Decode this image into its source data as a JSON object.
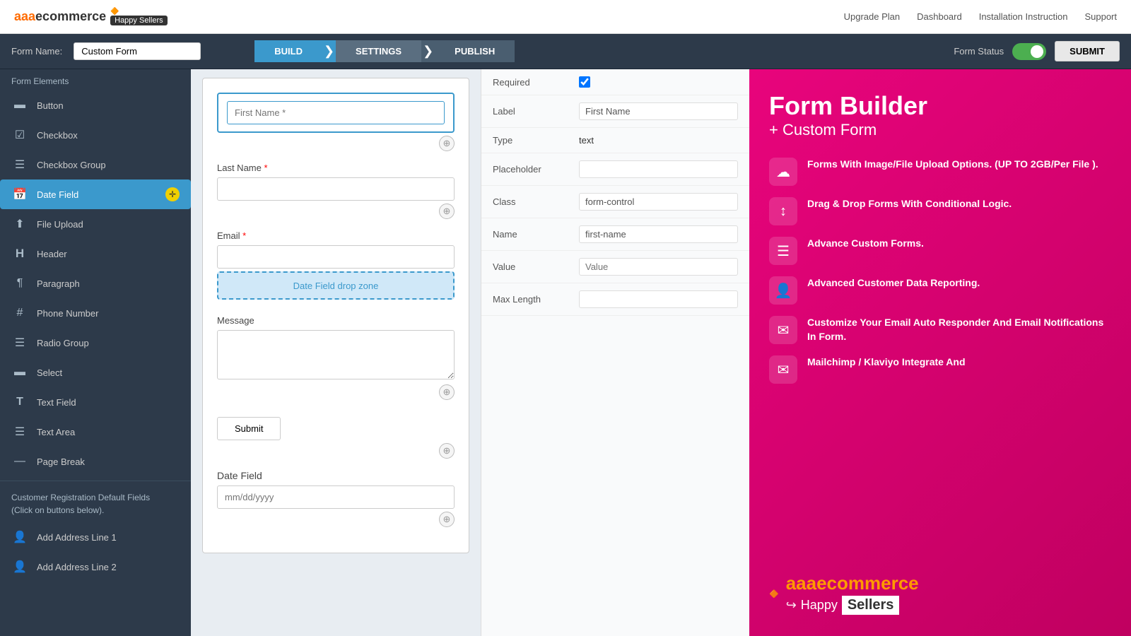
{
  "topNav": {
    "logo": "aaaecommerce",
    "logoHighlight": "aaa",
    "logoSub": "Happy Sellers",
    "links": [
      "Upgrade Plan",
      "Dashboard",
      "Installation Instruction",
      "Support"
    ]
  },
  "formHeader": {
    "formNameLabel": "Form Name:",
    "formNameValue": "Custom Form",
    "tabs": [
      "BUILD",
      "SETTINGS",
      "PUBLISH"
    ],
    "activeTab": "BUILD",
    "formStatusLabel": "Form Status",
    "submitLabel": "SUBMIT"
  },
  "sidebar": {
    "sectionTitle": "Form Elements",
    "items": [
      {
        "id": "button",
        "label": "Button",
        "icon": "▬"
      },
      {
        "id": "checkbox",
        "label": "Checkbox",
        "icon": "☑"
      },
      {
        "id": "checkbox-group",
        "label": "Checkbox Group",
        "icon": "☰"
      },
      {
        "id": "date-field",
        "label": "Date Field",
        "icon": "📅",
        "disabled": true
      },
      {
        "id": "file-upload",
        "label": "File Upload",
        "icon": "⬆"
      },
      {
        "id": "header",
        "label": "Header",
        "icon": "H"
      },
      {
        "id": "paragraph",
        "label": "Paragraph",
        "icon": "¶"
      },
      {
        "id": "phone-number",
        "label": "Phone Number",
        "icon": "#"
      },
      {
        "id": "radio-group",
        "label": "Radio Group",
        "icon": "☰"
      },
      {
        "id": "select",
        "label": "Select",
        "icon": "▬"
      },
      {
        "id": "text-field",
        "label": "Text Field",
        "icon": "T"
      },
      {
        "id": "text-area",
        "label": "Text Area",
        "icon": "☰"
      },
      {
        "id": "page-break",
        "label": "Page Break",
        "icon": "—"
      }
    ],
    "draggingItem": "date-field",
    "customerRegTitle": "Customer Registration Default Fields",
    "customerRegSub": "(Click on buttons below).",
    "addressItems": [
      {
        "id": "add-address-1",
        "label": "Add Address Line 1",
        "icon": "👤"
      },
      {
        "id": "add-address-2",
        "label": "Add Address Line 2",
        "icon": "👤"
      }
    ]
  },
  "formCanvas": {
    "fields": [
      {
        "id": "first-name",
        "label": "First Name",
        "required": true,
        "type": "text",
        "placeholder": "",
        "active": true
      },
      {
        "id": "last-name",
        "label": "Last Name",
        "required": true,
        "type": "text",
        "placeholder": ""
      },
      {
        "id": "email",
        "label": "Email",
        "required": true,
        "type": "text",
        "placeholder": ""
      },
      {
        "id": "message",
        "label": "Message",
        "type": "textarea",
        "placeholder": ""
      },
      {
        "id": "submit",
        "label": "Submit",
        "type": "submit"
      },
      {
        "id": "date-field",
        "label": "Date Field",
        "type": "date",
        "placeholder": "mm/dd/yyyy"
      }
    ]
  },
  "propertiesPanel": {
    "required": true,
    "label": "First Name",
    "type": "text",
    "placeholder": "",
    "class": "form-control",
    "name": "first-name",
    "value": "Value",
    "maxLength": "",
    "fields": [
      {
        "key": "required",
        "label": "Required",
        "type": "checkbox",
        "value": true
      },
      {
        "key": "label",
        "label": "Label",
        "type": "text",
        "value": "First Name"
      },
      {
        "key": "type",
        "label": "Type",
        "type": "text",
        "value": "text"
      },
      {
        "key": "placeholder",
        "label": "Placeholder",
        "type": "text",
        "value": ""
      },
      {
        "key": "class",
        "label": "Class",
        "type": "text",
        "value": "form-control"
      },
      {
        "key": "name",
        "label": "Name",
        "type": "text",
        "value": "first-name"
      },
      {
        "key": "value",
        "label": "Value",
        "type": "text",
        "value": "Value"
      },
      {
        "key": "maxLength",
        "label": "Max Length",
        "type": "text",
        "value": ""
      }
    ]
  },
  "rightPanel": {
    "title": "Form Builder",
    "subtitle": "+ Custom Form",
    "features": [
      {
        "icon": "☁",
        "text": "Forms With Image/File Upload Options. (UP TO 2GB/Per File )."
      },
      {
        "icon": "↕",
        "text": "Drag & Drop Forms With Conditional Logic."
      },
      {
        "icon": "☰",
        "text": "Advance Custom Forms."
      },
      {
        "icon": "👤",
        "text": "Advanced Customer Data Reporting."
      },
      {
        "icon": "✉",
        "text": "Customize Your Email Auto Responder And Email Notifications In Form."
      },
      {
        "icon": "✉",
        "text": "Mailchimp / Klaviyo Integrate And"
      }
    ],
    "bottomLogo": "aaaecommerce",
    "bottomLogoHighlight": "aaa",
    "bottomLogoSub": "Happy",
    "bottomLogoSellers": "Sellers"
  }
}
